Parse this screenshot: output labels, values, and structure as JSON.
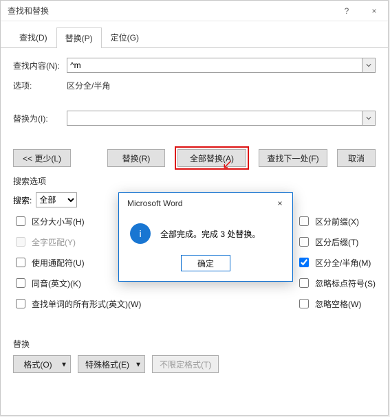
{
  "titlebar": {
    "title": "查找和替换",
    "help": "?",
    "close": "×"
  },
  "tabs": {
    "find": "查找(D)",
    "replace": "替换(P)",
    "goto": "定位(G)",
    "active": "replace"
  },
  "find": {
    "label": "查找内容(N):",
    "value": "^m",
    "options_label": "选项:",
    "options_value": "区分全/半角"
  },
  "replace": {
    "label": "替换为(I):",
    "value": ""
  },
  "buttons": {
    "less": "<< 更少(L)",
    "replace_one": "替换(R)",
    "replace_all": "全部替换(A)",
    "find_next": "查找下一处(F)",
    "cancel": "取消"
  },
  "search_section": {
    "title": "搜索选项",
    "direction_label": "搜索:",
    "direction_value": "全部"
  },
  "checks_left": [
    {
      "label": "区分大小写(H)",
      "checked": false,
      "enabled": true
    },
    {
      "label": "全字匹配(Y)",
      "checked": false,
      "enabled": false
    },
    {
      "label": "使用通配符(U)",
      "checked": false,
      "enabled": true
    },
    {
      "label": "同音(英文)(K)",
      "checked": false,
      "enabled": true
    },
    {
      "label": "查找单词的所有形式(英文)(W)",
      "checked": false,
      "enabled": true
    }
  ],
  "checks_right": [
    {
      "label": "区分前缀(X)",
      "checked": false
    },
    {
      "label": "区分后缀(T)",
      "checked": false
    },
    {
      "label": "区分全/半角(M)",
      "checked": true
    },
    {
      "label": "忽略标点符号(S)",
      "checked": false
    },
    {
      "label": "忽略空格(W)",
      "checked": false
    }
  ],
  "replace_section": {
    "title": "替换",
    "format": "格式(O)",
    "special": "特殊格式(E)",
    "nolimit": "不限定格式(T)"
  },
  "msgbox": {
    "title": "Microsoft Word",
    "text": "全部完成。完成 3 处替换。",
    "ok": "确定",
    "close": "×",
    "icon": "i"
  }
}
